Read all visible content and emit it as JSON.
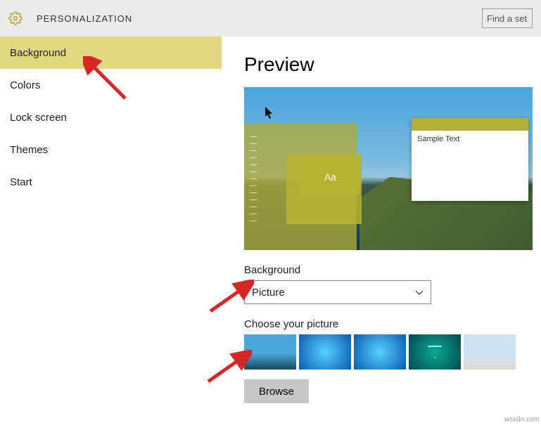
{
  "header": {
    "title": "PERSONALIZATION",
    "search_placeholder": "Find a set"
  },
  "sidebar": {
    "items": [
      {
        "label": "Background",
        "selected": true
      },
      {
        "label": "Colors"
      },
      {
        "label": "Lock screen"
      },
      {
        "label": "Themes"
      },
      {
        "label": "Start"
      }
    ]
  },
  "main": {
    "preview_heading": "Preview",
    "sample_window_text": "Sample Text",
    "aa_label": "Aa",
    "background_label": "Background",
    "dropdown_value": "Picture",
    "choose_picture_label": "Choose your picture",
    "browse_label": "Browse"
  },
  "colors": {
    "accent": "#b5ae37"
  },
  "watermark": "wsxdn.com"
}
